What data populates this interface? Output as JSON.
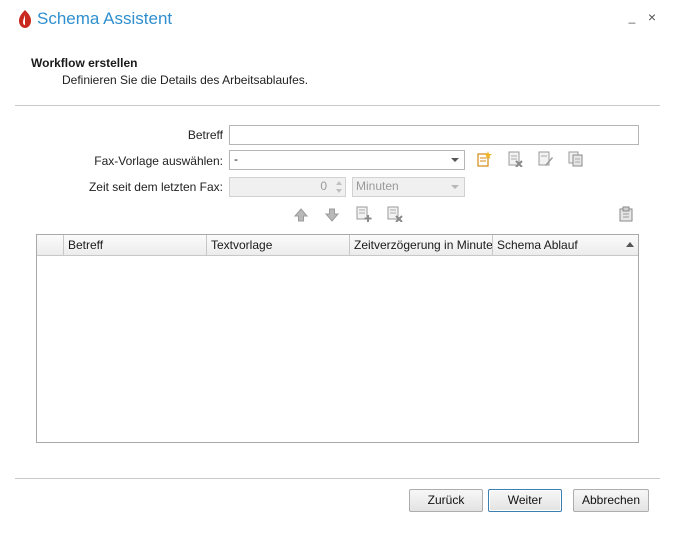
{
  "window": {
    "title": "Schema Assistent",
    "minimize_glyph": "_",
    "close_glyph": "×"
  },
  "header": {
    "title": "Workflow erstellen",
    "subtitle": "Definieren Sie die Details des Arbeitsablaufes."
  },
  "form": {
    "subject_label": "Betreff",
    "subject_value": "",
    "template_label": "Fax-Vorlage auswählen:",
    "template_value": "-",
    "time_label": "Zeit seit dem letzten Fax:",
    "time_value": "0",
    "time_unit": "Minuten",
    "template_icons": [
      "new-document-icon",
      "delete-document-icon",
      "edit-document-icon",
      "copy-document-icon"
    ]
  },
  "toolbar": {
    "icons": [
      "move-up-icon",
      "move-down-icon",
      "add-row-icon",
      "delete-row-icon",
      "clipboard-icon"
    ]
  },
  "grid": {
    "columns": [
      "Betreff",
      "Textvorlage",
      "Zeitverzögerung in Minuten",
      "Schema Ablauf"
    ],
    "rows": []
  },
  "footer": {
    "back_label": "Zurück",
    "next_label": "Weiter",
    "cancel_label": "Abbrechen"
  },
  "colors": {
    "title_blue": "#2f8fce",
    "logo_red": "#c8281e",
    "accent_orange": "#e09a1f"
  }
}
